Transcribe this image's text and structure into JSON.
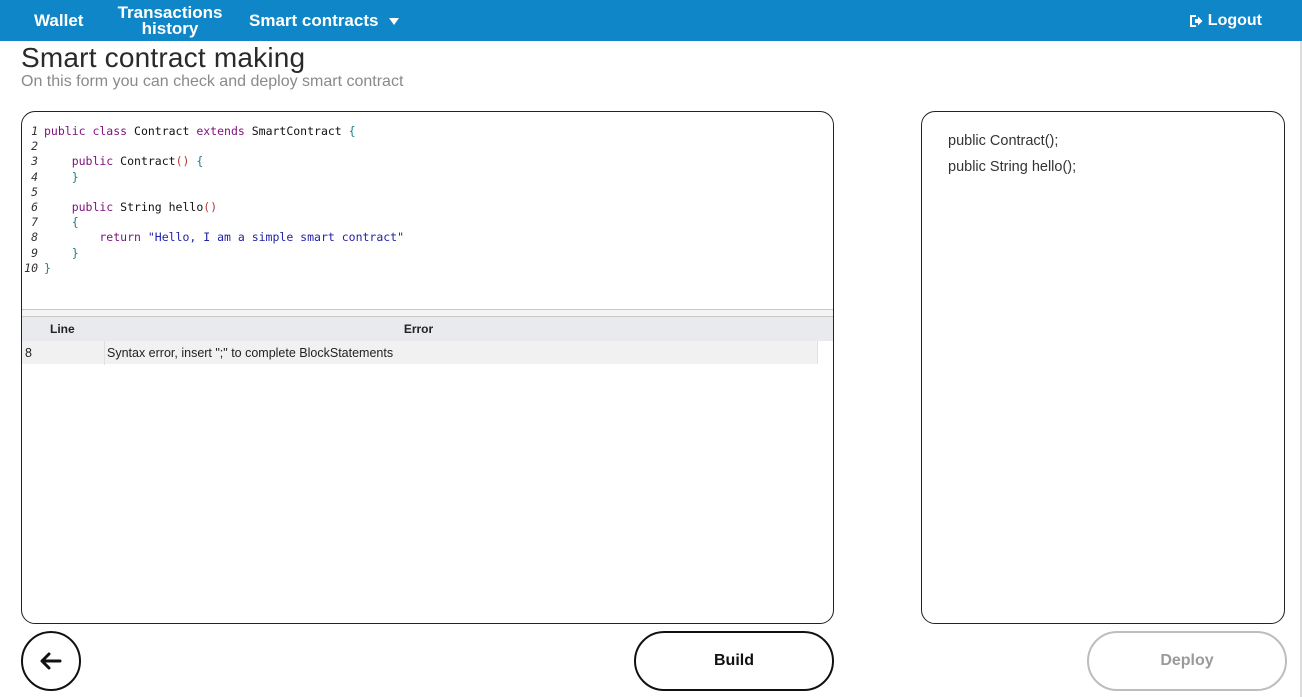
{
  "nav": {
    "wallet": "Wallet",
    "transactions_line1": "Transactions",
    "transactions_line2": "history",
    "smart_contracts": "Smart contracts",
    "logout": "Logout",
    "bar_color": "#0f86c8",
    "icons": {
      "dropdown": "caret-down-icon",
      "logout": "logout-icon"
    }
  },
  "page": {
    "title": "Smart contract making",
    "subtitle": "On this form you can check and deploy smart contract"
  },
  "editor": {
    "lines": [
      {
        "n": "1",
        "tokens": [
          {
            "t": "public class ",
            "c": "kw"
          },
          {
            "t": "Contract ",
            "c": "plain"
          },
          {
            "t": "extends ",
            "c": "kw"
          },
          {
            "t": "SmartContract ",
            "c": "plain"
          },
          {
            "t": "{",
            "c": "brc"
          }
        ]
      },
      {
        "n": "2",
        "tokens": []
      },
      {
        "n": "3",
        "tokens": [
          {
            "t": "    public ",
            "c": "kw"
          },
          {
            "t": "Contract",
            "c": "plain"
          },
          {
            "t": "()",
            "c": "br"
          },
          {
            "t": " ",
            "c": "plain"
          },
          {
            "t": "{",
            "c": "brc"
          }
        ]
      },
      {
        "n": "4",
        "tokens": [
          {
            "t": "    }",
            "c": "brc"
          }
        ]
      },
      {
        "n": "5",
        "tokens": []
      },
      {
        "n": "6",
        "tokens": [
          {
            "t": "    public ",
            "c": "kw"
          },
          {
            "t": "String hello",
            "c": "plain"
          },
          {
            "t": "()",
            "c": "br"
          }
        ]
      },
      {
        "n": "7",
        "tokens": [
          {
            "t": "    {",
            "c": "brc"
          }
        ]
      },
      {
        "n": "8",
        "tokens": [
          {
            "t": "        return ",
            "c": "kw"
          },
          {
            "t": "\"Hello, I am a simple smart contract\"",
            "c": "str"
          }
        ]
      },
      {
        "n": "9",
        "tokens": [
          {
            "t": "    }",
            "c": "brc"
          }
        ]
      },
      {
        "n": "10",
        "tokens": [
          {
            "t": "}",
            "c": "brc"
          }
        ]
      }
    ]
  },
  "errors": {
    "col_line": "Line",
    "col_error": "Error",
    "rows": [
      {
        "line": "8",
        "error": "Syntax error, insert \";\" to complete BlockStatements"
      }
    ]
  },
  "methods": [
    "public Contract();",
    "public String hello();"
  ],
  "buttons": {
    "back_icon": "arrow-left-icon",
    "build": "Build",
    "deploy": "Deploy"
  }
}
